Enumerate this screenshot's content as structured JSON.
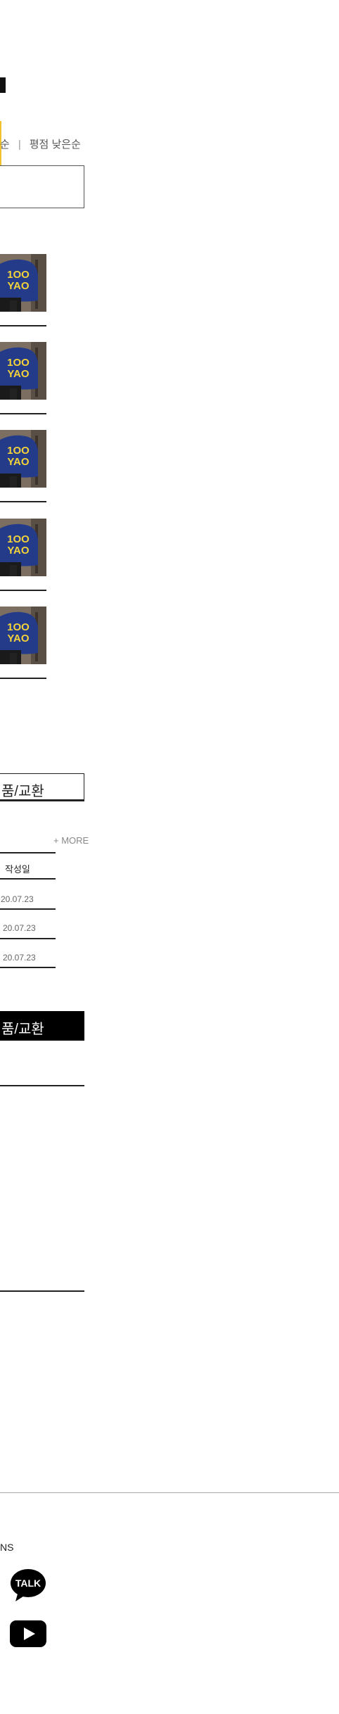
{
  "sort": {
    "partial_label": "순",
    "separator": "|",
    "low_rating_label": "평점 낮은순"
  },
  "products": [
    {
      "shirt_text": "1OO\nYAO"
    },
    {
      "shirt_text": "1OO\nYAO"
    },
    {
      "shirt_text": "1OO\nYAO"
    },
    {
      "shirt_text": "1OO\nYAO"
    },
    {
      "shirt_text": "1OO\nYAO"
    }
  ],
  "qa_tab": {
    "label": "품/교환",
    "more_label": "+ MORE",
    "date_header": "작성일",
    "dates": [
      "20.07.23",
      "20.07.23",
      "20.07.23"
    ]
  },
  "review_tab": {
    "label": "품/교환"
  },
  "footer": {
    "sns_label": "NS",
    "kakao_text": "TALK"
  },
  "colors": {
    "accent": "#f2c12e",
    "shirt_blue": "#243b8a",
    "shirt_text": "#f3d23a"
  }
}
